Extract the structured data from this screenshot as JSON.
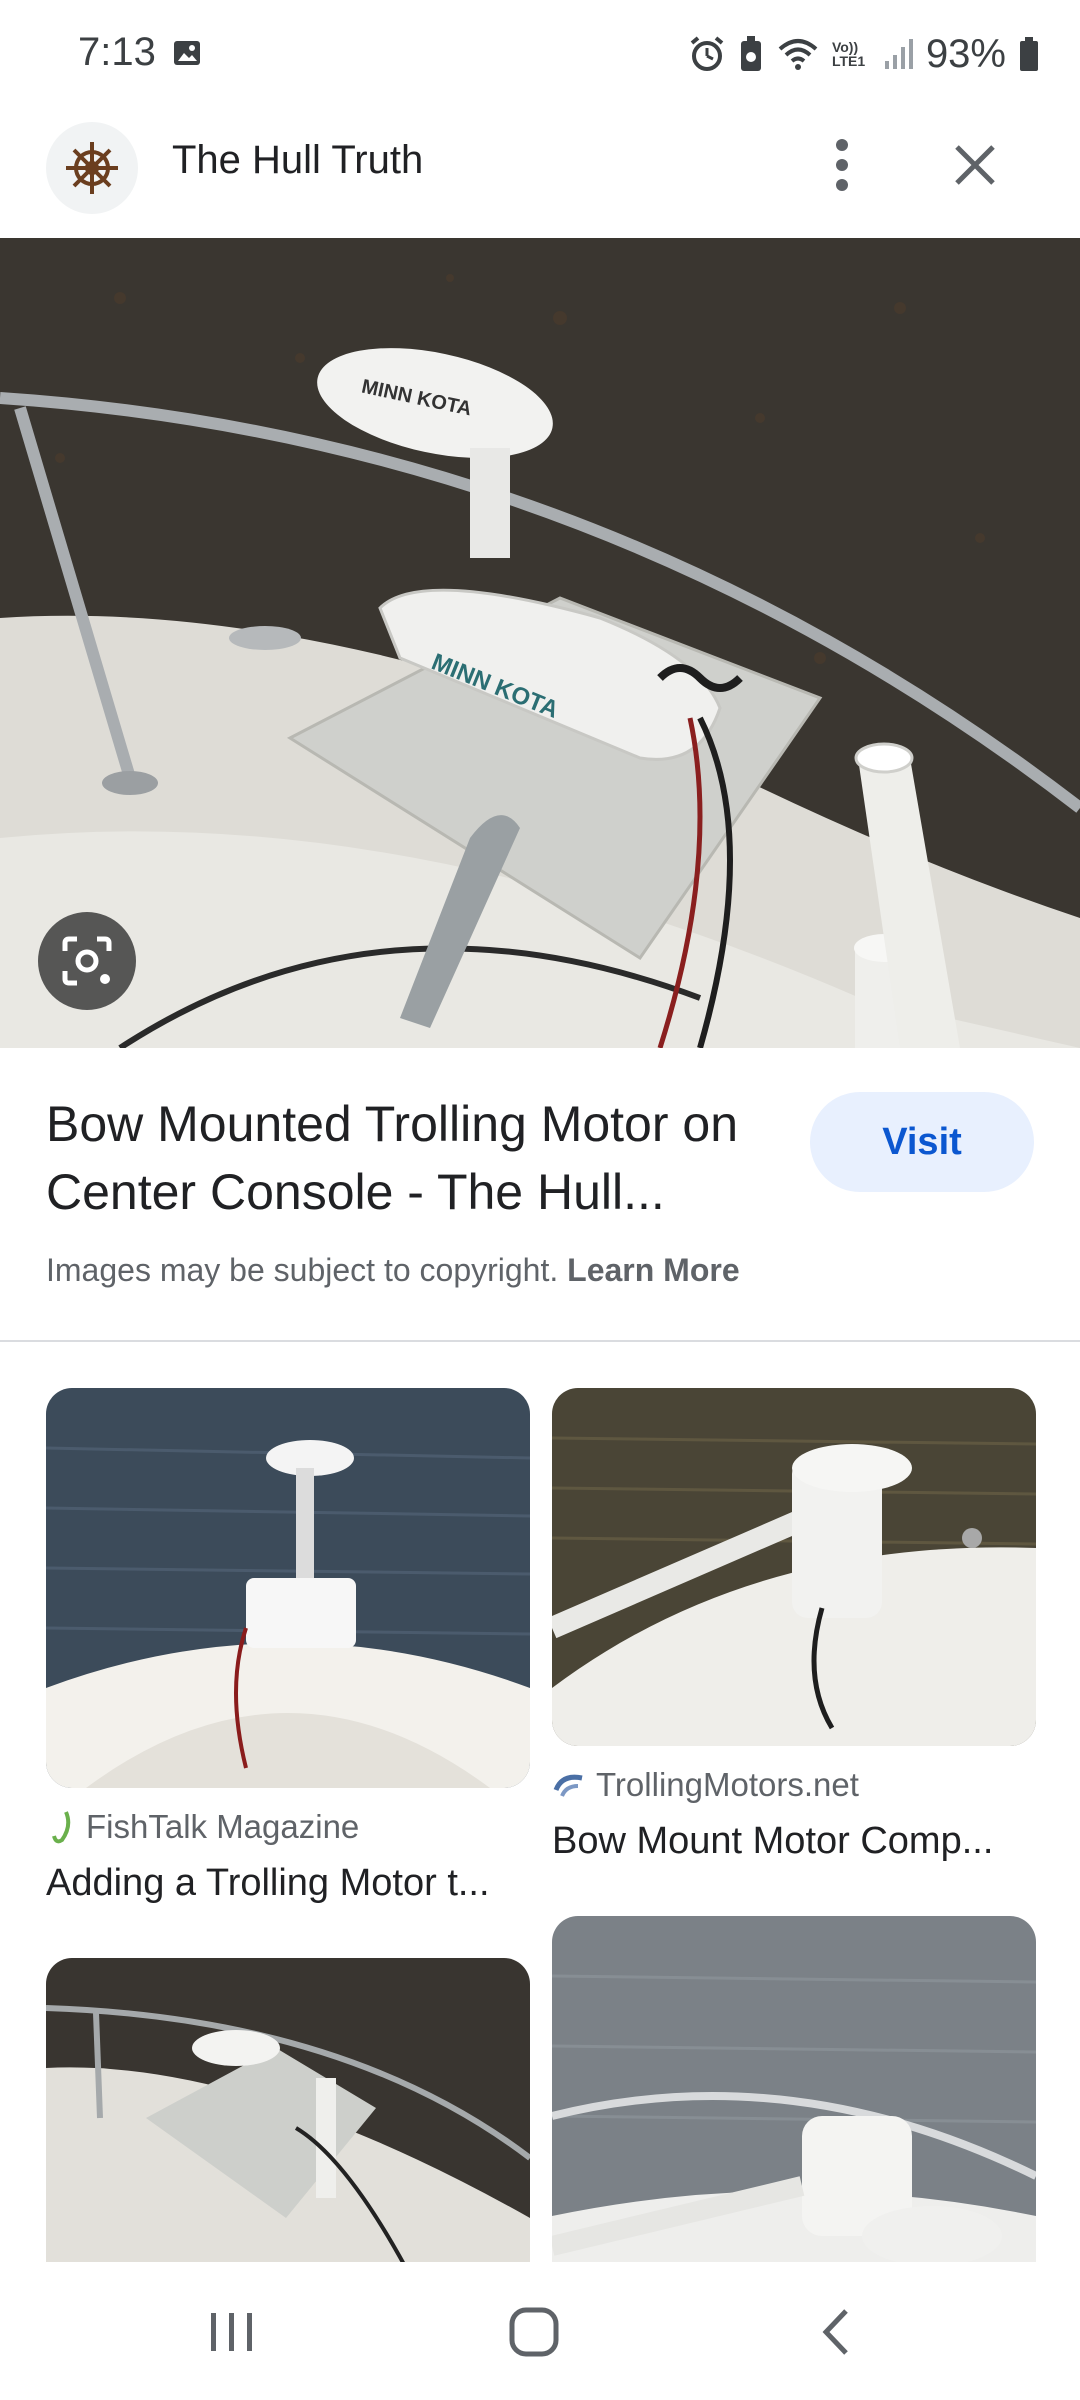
{
  "status_bar": {
    "time": "7:13",
    "battery": "93%",
    "network_label": "Vo)) LTE1"
  },
  "header": {
    "site_name": "The Hull Truth",
    "icons": [
      "ship-wheel-icon",
      "more-vert-icon",
      "close-icon"
    ]
  },
  "result": {
    "title": "Bow Mounted Trolling Motor on Center Console - The Hull...",
    "visit_label": "Visit",
    "copyright_text": "Images may be subject to copyright.",
    "learn_more": "Learn More"
  },
  "related": [
    {
      "source": "FishTalk Magazine",
      "title": "Adding a Trolling Motor t..."
    },
    {
      "source": "TrollingMotors.net",
      "title": "Bow Mount Motor Comp..."
    }
  ],
  "colors": {
    "accent": "#0b57d0",
    "visit_bg": "#e8f0fe",
    "text_primary": "#202124",
    "text_secondary": "#5f6368"
  }
}
